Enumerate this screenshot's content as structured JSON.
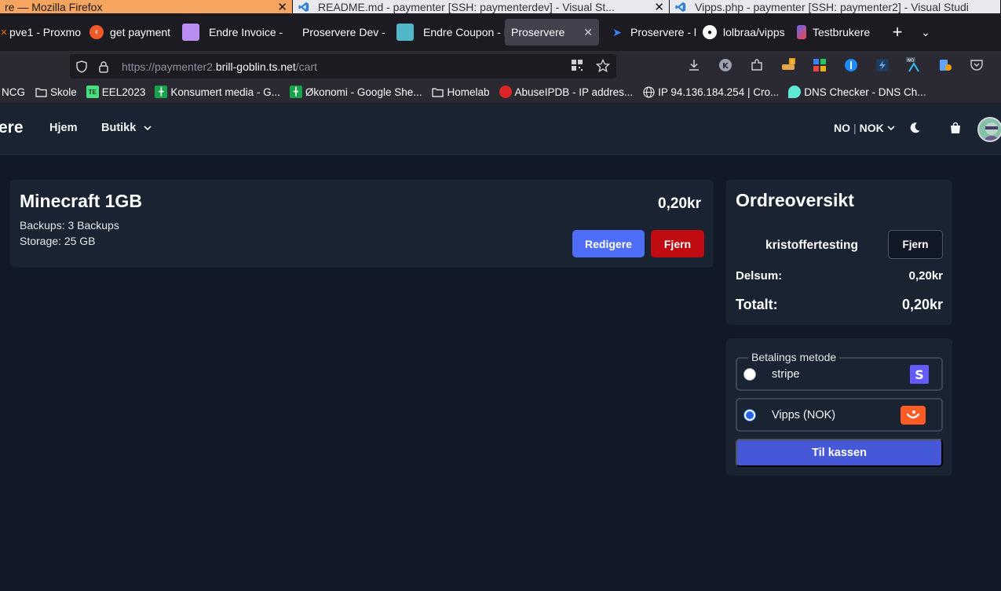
{
  "os_windows": [
    {
      "title": "re — Mozilla Firefox",
      "active": true
    },
    {
      "title": "README.md - paymenter [SSH: paymenterdev] - Visual St...",
      "active": false
    },
    {
      "title": "Vipps.php - paymenter [SSH: paymenter2] - Visual Studi",
      "active": false
    }
  ],
  "browser_tabs": [
    {
      "label": "pve1 - Proxmo",
      "icon": "proxmox-icon",
      "color": "#e57000"
    },
    {
      "label": "get payment",
      "icon": "orange-logo-icon",
      "color": "#f05a28"
    },
    {
      "label": "Endre Invoice - P",
      "icon": "purple-square-icon",
      "color": "#b98cf0"
    },
    {
      "label": "Proservere Dev -",
      "icon": "none",
      "color": ""
    },
    {
      "label": "Endre Coupon - P",
      "icon": "teal-square-icon",
      "color": "#4fb7c8"
    },
    {
      "label": "Proservere",
      "icon": "none",
      "color": "",
      "active": true
    },
    {
      "label": "Proservere - l",
      "icon": "bird-icon",
      "color": "#3b82f6"
    },
    {
      "label": "lolbraa/vipps",
      "icon": "github-icon",
      "color": "#fff"
    },
    {
      "label": "Testbrukere",
      "icon": "bookmark-logo-icon",
      "color": "#6366f1"
    }
  ],
  "url": {
    "prefix": "https://paymenter2.",
    "host": "brill-goblin.ts.net",
    "path": "/cart"
  },
  "bookmarks": [
    {
      "label": "NCG",
      "icon": "none"
    },
    {
      "label": "Skole",
      "icon": "folder-icon"
    },
    {
      "label": "EEL2023",
      "icon": "te-icon"
    },
    {
      "label": "Konsumert media - G...",
      "icon": "sheets-icon"
    },
    {
      "label": "Økonomi - Google She...",
      "icon": "sheets-icon"
    },
    {
      "label": "Homelab",
      "icon": "folder-icon"
    },
    {
      "label": "AbuseIPDB - IP addres...",
      "icon": "abuseipdb-icon"
    },
    {
      "label": "IP 94.136.184.254 | Cro...",
      "icon": "globe-icon"
    },
    {
      "label": "DNS Checker - DNS Ch...",
      "icon": "dns-icon"
    }
  ],
  "header": {
    "brand": "ere",
    "nav_home": "Hjem",
    "nav_shop": "Butikk",
    "locale_lang": "NO",
    "locale_sep": "|",
    "locale_currency": "NOK"
  },
  "cart_item": {
    "title": "Minecraft 1GB",
    "line1": "Backups: 3 Backups",
    "line2": "Storage: 25 GB",
    "price": "0,20kr",
    "edit_label": "Redigere",
    "remove_label": "Fjern"
  },
  "summary": {
    "title": "Ordreoversikt",
    "coupon": "kristoffertesting",
    "coupon_remove": "Fjern",
    "subtotal_label": "Delsum:",
    "subtotal_value": "0,20kr",
    "total_label": "Totalt:",
    "total_value": "0,20kr"
  },
  "payment": {
    "legend": "Betalings metode",
    "options": [
      {
        "label": "stripe",
        "checked": false
      },
      {
        "label": "Vipps (NOK)",
        "checked": true
      }
    ],
    "checkout_label": "Til kassen"
  },
  "colors": {
    "page_bg": "#111827",
    "card_bg": "#1a2332",
    "edit_button": "#4f6ef7",
    "remove_button": "#c00b12",
    "checkout_button": "#4458d8",
    "stripe_brand": "#635bff",
    "vipps_brand": "#ff5b24"
  }
}
